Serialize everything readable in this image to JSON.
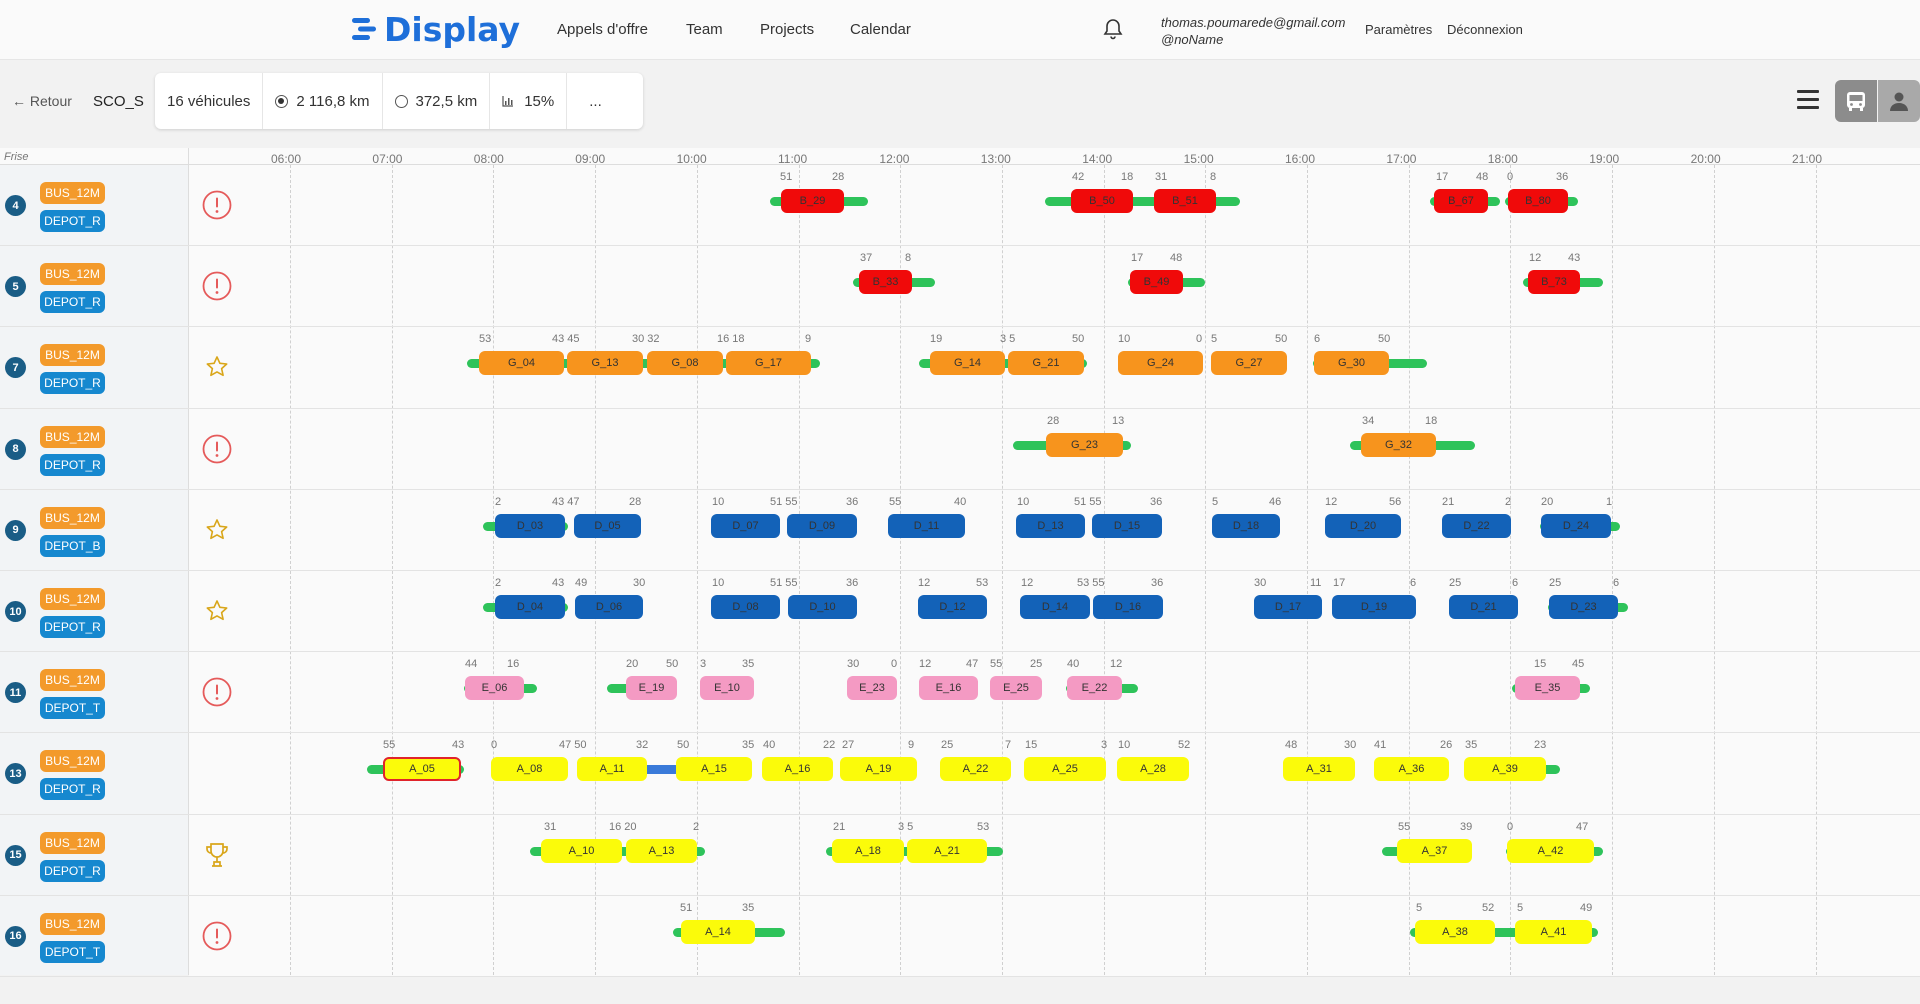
{
  "nav": {
    "logo_text": "Display",
    "links": [
      "Appels d'offre",
      "Team",
      "Projects",
      "Calendar"
    ],
    "user_email": "thomas.poumarede@gmail.com",
    "user_handle": "@noName",
    "settings": "Paramètres",
    "logout": "Déconnexion"
  },
  "toolbar": {
    "back": "← Retour",
    "project": "SCO_S",
    "vehicles": "16 véhicules",
    "km1": "2 116,8 km",
    "km2": "372,5 km",
    "pct": "15%",
    "more": "..."
  },
  "frise": "Frise",
  "hours": [
    "06:00",
    "07:00",
    "08:00",
    "09:00",
    "10:00",
    "11:00",
    "12:00",
    "13:00",
    "14:00",
    "15:00",
    "16:00",
    "17:00",
    "18:00",
    "19:00",
    "20:00",
    "21:00"
  ],
  "rows": [
    {
      "num": "4",
      "bus": "BUS_12M",
      "depot": "DEPOT_R",
      "status": "alert",
      "bars": [
        [
          770,
          868
        ],
        [
          1045,
          1240
        ],
        [
          1430,
          1500
        ],
        [
          1505,
          1578
        ]
      ],
      "blocks": [
        [
          "B_29",
          781,
          844,
          "r"
        ],
        [
          "B_50",
          1071,
          1133,
          "r"
        ],
        [
          "B_51",
          1154,
          1216,
          "r"
        ],
        [
          "B_67",
          1434,
          1488,
          "r"
        ],
        [
          "B_80",
          1508,
          1568,
          "r"
        ]
      ],
      "nums": [
        [
          "51",
          780
        ],
        [
          "28",
          832
        ],
        [
          "42",
          1072
        ],
        [
          "18",
          1121
        ],
        [
          "31",
          1155
        ],
        [
          "8",
          1210
        ],
        [
          "17",
          1436
        ],
        [
          "48",
          1476
        ],
        [
          "0",
          1507
        ],
        [
          "36",
          1556
        ]
      ]
    },
    {
      "num": "5",
      "bus": "BUS_12M",
      "depot": "DEPOT_R",
      "status": "alert",
      "bars": [
        [
          853,
          935
        ],
        [
          1128,
          1205
        ],
        [
          1523,
          1603
        ]
      ],
      "blocks": [
        [
          "B_33",
          859,
          912,
          "r"
        ],
        [
          "B_49",
          1130,
          1183,
          "r"
        ],
        [
          "B_73",
          1528,
          1580,
          "r"
        ]
      ],
      "nums": [
        [
          "37",
          860
        ],
        [
          "8",
          905
        ],
        [
          "17",
          1131
        ],
        [
          "48",
          1170
        ],
        [
          "12",
          1529
        ],
        [
          "43",
          1568
        ]
      ]
    },
    {
      "num": "7",
      "bus": "BUS_12M",
      "depot": "DEPOT_R",
      "status": "star",
      "bars": [
        [
          467,
          820
        ],
        [
          919,
          1087
        ],
        [
          1313,
          1427
        ]
      ],
      "blocks": [
        [
          "G_04",
          479,
          564,
          "o"
        ],
        [
          "G_13",
          567,
          643,
          "o"
        ],
        [
          "G_08",
          647,
          723,
          "o"
        ],
        [
          "G_17",
          726,
          811,
          "o"
        ],
        [
          "G_14",
          930,
          1005,
          "o"
        ],
        [
          "G_21",
          1008,
          1084,
          "o"
        ],
        [
          "G_24",
          1118,
          1203,
          "o"
        ],
        [
          "G_27",
          1211,
          1287,
          "o"
        ],
        [
          "G_30",
          1314,
          1389,
          "o"
        ]
      ],
      "nums": [
        [
          "53",
          479
        ],
        [
          "43 45",
          552
        ],
        [
          "30 32",
          632
        ],
        [
          "16 18",
          717
        ],
        [
          "9",
          805
        ],
        [
          "19",
          930
        ],
        [
          "3 5",
          1000
        ],
        [
          "50",
          1072
        ],
        [
          "10",
          1118
        ],
        [
          "0",
          1196
        ],
        [
          "5",
          1211
        ],
        [
          "50",
          1275
        ],
        [
          "6",
          1314
        ],
        [
          "50",
          1378
        ]
      ]
    },
    {
      "num": "8",
      "bus": "BUS_12M",
      "depot": "DEPOT_R",
      "status": "alert",
      "bars": [
        [
          1013,
          1131
        ],
        [
          1350,
          1475
        ]
      ],
      "blocks": [
        [
          "G_23",
          1046,
          1123,
          "o"
        ],
        [
          "G_32",
          1361,
          1436,
          "o"
        ]
      ],
      "nums": [
        [
          "28",
          1047
        ],
        [
          "13",
          1112
        ],
        [
          "34",
          1362
        ],
        [
          "18",
          1425
        ]
      ]
    },
    {
      "num": "9",
      "bus": "BUS_12M",
      "depot": "DEPOT_B",
      "status": "star",
      "bars": [
        [
          483,
          568
        ],
        [
          1540,
          1620
        ]
      ],
      "blocks": [
        [
          "D_03",
          495,
          565,
          "b"
        ],
        [
          "D_05",
          574,
          641,
          "b"
        ],
        [
          "D_07",
          711,
          780,
          "b"
        ],
        [
          "D_09",
          787,
          857,
          "b"
        ],
        [
          "D_11",
          888,
          965,
          "b"
        ],
        [
          "D_13",
          1016,
          1085,
          "b"
        ],
        [
          "D_15",
          1092,
          1162,
          "b"
        ],
        [
          "D_18",
          1212,
          1280,
          "b"
        ],
        [
          "D_20",
          1325,
          1401,
          "b"
        ],
        [
          "D_22",
          1442,
          1511,
          "b"
        ],
        [
          "D_24",
          1541,
          1611,
          "b"
        ]
      ],
      "nums": [
        [
          "2",
          495
        ],
        [
          "43 47",
          552
        ],
        [
          "28",
          629
        ],
        [
          "10",
          712
        ],
        [
          "51 55",
          770
        ],
        [
          "36",
          846
        ],
        [
          "55",
          889
        ],
        [
          "40",
          954
        ],
        [
          "10",
          1017
        ],
        [
          "51 55",
          1074
        ],
        [
          "36",
          1150
        ],
        [
          "5",
          1212
        ],
        [
          "46",
          1269
        ],
        [
          "12",
          1325
        ],
        [
          "56",
          1389
        ],
        [
          "21",
          1442
        ],
        [
          "2",
          1505
        ],
        [
          "20",
          1541
        ],
        [
          "1",
          1606
        ]
      ]
    },
    {
      "num": "10",
      "bus": "BUS_12M",
      "depot": "DEPOT_R",
      "status": "star",
      "bars": [
        [
          483,
          568
        ],
        [
          1548,
          1628
        ]
      ],
      "blocks": [
        [
          "D_04",
          495,
          565,
          "b"
        ],
        [
          "D_06",
          575,
          643,
          "b"
        ],
        [
          "D_08",
          711,
          780,
          "b"
        ],
        [
          "D_10",
          788,
          857,
          "b"
        ],
        [
          "D_12",
          918,
          987,
          "b"
        ],
        [
          "D_14",
          1020,
          1090,
          "b"
        ],
        [
          "D_16",
          1093,
          1163,
          "b"
        ],
        [
          "D_17",
          1254,
          1322,
          "b"
        ],
        [
          "D_19",
          1332,
          1416,
          "b"
        ],
        [
          "D_21",
          1449,
          1518,
          "b"
        ],
        [
          "D_23",
          1549,
          1618,
          "b"
        ]
      ],
      "nums": [
        [
          "2",
          495
        ],
        [
          "43",
          552
        ],
        [
          "49",
          575
        ],
        [
          "30",
          633
        ],
        [
          "10",
          712
        ],
        [
          "51 55",
          770
        ],
        [
          "36",
          846
        ],
        [
          "12",
          918
        ],
        [
          "53",
          976
        ],
        [
          "12",
          1021
        ],
        [
          "53 55",
          1077
        ],
        [
          "36",
          1151
        ],
        [
          "30",
          1254
        ],
        [
          "11",
          1310
        ],
        [
          "17",
          1333
        ],
        [
          "6",
          1410
        ],
        [
          "25",
          1449
        ],
        [
          "6",
          1512
        ],
        [
          "25",
          1549
        ],
        [
          "6",
          1613
        ]
      ]
    },
    {
      "num": "11",
      "bus": "BUS_12M",
      "depot": "DEPOT_T",
      "status": "alert",
      "bars": [
        [
          464,
          537
        ],
        [
          607,
          670
        ],
        [
          1066,
          1138
        ],
        [
          1512,
          1590
        ]
      ],
      "blocks": [
        [
          "E_06",
          465,
          524,
          "p"
        ],
        [
          "E_19",
          626,
          677,
          "p"
        ],
        [
          "E_10",
          700,
          754,
          "p"
        ],
        [
          "E_23",
          847,
          897,
          "p"
        ],
        [
          "E_16",
          919,
          978,
          "p"
        ],
        [
          "E_25",
          990,
          1042,
          "p"
        ],
        [
          "E_22",
          1067,
          1122,
          "p"
        ],
        [
          "E_35",
          1515,
          1580,
          "p"
        ]
      ],
      "nums": [
        [
          "44",
          465
        ],
        [
          "16",
          507
        ],
        [
          "20",
          626
        ],
        [
          "50",
          666
        ],
        [
          "3",
          700
        ],
        [
          "35",
          742
        ],
        [
          "30",
          847
        ],
        [
          "0",
          891
        ],
        [
          "12",
          919
        ],
        [
          "47",
          966
        ],
        [
          "55",
          990
        ],
        [
          "25",
          1030
        ],
        [
          "40",
          1067
        ],
        [
          "12",
          1110
        ],
        [
          "15",
          1534
        ],
        [
          "45",
          1572
        ]
      ]
    },
    {
      "num": "13",
      "bus": "BUS_12M",
      "depot": "DEPOT_R",
      "status": "none",
      "bars": [
        [
          367,
          464
        ],
        [
          1472,
          1560
        ]
      ],
      "blue": [
        [
          640,
          680
        ]
      ],
      "blocks": [
        [
          "A_05",
          383,
          461,
          "y",
          true
        ],
        [
          "A_08",
          491,
          568,
          "y"
        ],
        [
          "A_11",
          577,
          647,
          "y"
        ],
        [
          "A_15",
          676,
          752,
          "y"
        ],
        [
          "A_16",
          762,
          833,
          "y"
        ],
        [
          "A_19",
          840,
          917,
          "y"
        ],
        [
          "A_22",
          940,
          1011,
          "y"
        ],
        [
          "A_25",
          1024,
          1106,
          "y"
        ],
        [
          "A_28",
          1117,
          1189,
          "y"
        ],
        [
          "A_31",
          1283,
          1355,
          "y"
        ],
        [
          "A_36",
          1374,
          1449,
          "y"
        ],
        [
          "A_39",
          1464,
          1546,
          "y"
        ]
      ],
      "nums": [
        [
          "55",
          383
        ],
        [
          "43",
          452
        ],
        [
          "0",
          491
        ],
        [
          "47 50",
          559
        ],
        [
          "32",
          636
        ],
        [
          "50",
          677
        ],
        [
          "35",
          742
        ],
        [
          "40",
          763
        ],
        [
          "22",
          823
        ],
        [
          "27",
          842
        ],
        [
          "9",
          908
        ],
        [
          "25",
          941
        ],
        [
          "7",
          1005
        ],
        [
          "15",
          1025
        ],
        [
          "3",
          1101
        ],
        [
          "10",
          1118
        ],
        [
          "52",
          1178
        ],
        [
          "48",
          1285
        ],
        [
          "30",
          1344
        ],
        [
          "41",
          1374
        ],
        [
          "26",
          1440
        ],
        [
          "35",
          1465
        ],
        [
          "23",
          1534
        ]
      ]
    },
    {
      "num": "15",
      "bus": "BUS_12M",
      "depot": "DEPOT_R",
      "status": "trophy",
      "bars": [
        [
          530,
          705
        ],
        [
          826,
          1003
        ],
        [
          1382,
          1471
        ],
        [
          1506,
          1603
        ]
      ],
      "blocks": [
        [
          "A_10",
          541,
          622,
          "y"
        ],
        [
          "A_13",
          626,
          697,
          "y"
        ],
        [
          "A_18",
          832,
          904,
          "y"
        ],
        [
          "A_21",
          907,
          987,
          "y"
        ],
        [
          "A_37",
          1397,
          1472,
          "y"
        ],
        [
          "A_42",
          1507,
          1594,
          "y"
        ]
      ],
      "nums": [
        [
          "31",
          544
        ],
        [
          "16 20",
          609
        ],
        [
          "2",
          693
        ],
        [
          "21",
          833
        ],
        [
          "3 5",
          898
        ],
        [
          "53",
          977
        ],
        [
          "55",
          1398
        ],
        [
          "39",
          1460
        ],
        [
          "0",
          1507
        ],
        [
          "47",
          1576
        ]
      ]
    },
    {
      "num": "16",
      "bus": "BUS_12M",
      "depot": "DEPOT_T",
      "status": "alert",
      "bars": [
        [
          673,
          785
        ],
        [
          1410,
          1598
        ]
      ],
      "blocks": [
        [
          "A_14",
          681,
          755,
          "y"
        ],
        [
          "A_38",
          1415,
          1495,
          "y"
        ],
        [
          "A_41",
          1515,
          1592,
          "y"
        ]
      ],
      "nums": [
        [
          "51",
          680
        ],
        [
          "35",
          742
        ],
        [
          "5",
          1416
        ],
        [
          "52",
          1482
        ],
        [
          "5",
          1517
        ],
        [
          "49",
          1580
        ]
      ]
    }
  ]
}
